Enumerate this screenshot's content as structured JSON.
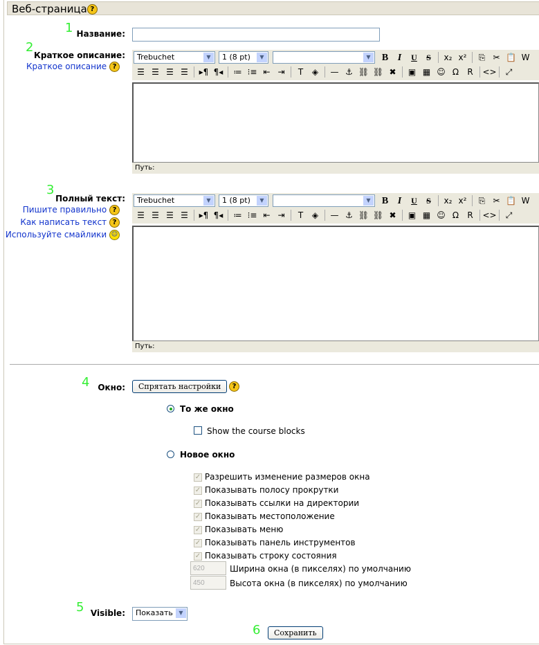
{
  "header": {
    "title": "Веб-страница",
    "help": "?"
  },
  "markers": [
    "1",
    "2",
    "3",
    "4",
    "5",
    "6"
  ],
  "name": {
    "label": "Название:",
    "value": ""
  },
  "summary": {
    "label": "Краткое описание:",
    "links": [
      {
        "text": "Краткое описание",
        "icon": "help-icon"
      }
    ]
  },
  "fulltext": {
    "label": "Полный текст:",
    "links": [
      {
        "text": "Пишите правильно",
        "icon": "help-icon"
      },
      {
        "text": "Как написать текст",
        "icon": "help-icon"
      },
      {
        "text": "Используйте смайлики",
        "icon": "smiley-icon"
      }
    ]
  },
  "editor": {
    "font": "Trebuchet",
    "size": "1 (8 pt)",
    "format": "",
    "path_label": "Путь:",
    "row1": [
      "bold",
      "italic",
      "underline",
      "strikethrough",
      "|",
      "subscript",
      "superscript",
      "|",
      "copy",
      "cut",
      "paste",
      "paste-word"
    ],
    "row2": [
      "align-left",
      "align-center",
      "align-right",
      "justify",
      "|",
      "ltr",
      "rtl",
      "|",
      "ordered-list",
      "unordered-list",
      "outdent",
      "indent",
      "|",
      "text-color",
      "highlight-color",
      "|",
      "horizontal-rule",
      "anchor",
      "link",
      "unlink",
      "nolink",
      "|",
      "image",
      "table",
      "smiley",
      "special-char",
      "cleanup",
      "|",
      "html-source",
      "|",
      "fullscreen"
    ]
  },
  "window": {
    "label": "Окно:",
    "hide_button": "Спрятать настройки",
    "same_window": "То же окно",
    "same_selected": true,
    "show_blocks": "Show the course blocks",
    "new_window": "Новое окно",
    "options": [
      "Разрешить изменение размеров окна",
      "Показывать полосу прокрутки",
      "Показывать ссылки на директории",
      "Показывать местоположение",
      "Показывать меню",
      "Показывать панель инструментов",
      "Показывать строку состояния"
    ],
    "width_value": "620",
    "width_label": "Ширина окна (в пикселях) по умолчанию",
    "height_value": "450",
    "height_label": "Высота окна (в пикселях) по умолчанию"
  },
  "visible": {
    "label": "Visible:",
    "value": "Показать"
  },
  "save_button": "Сохранить"
}
